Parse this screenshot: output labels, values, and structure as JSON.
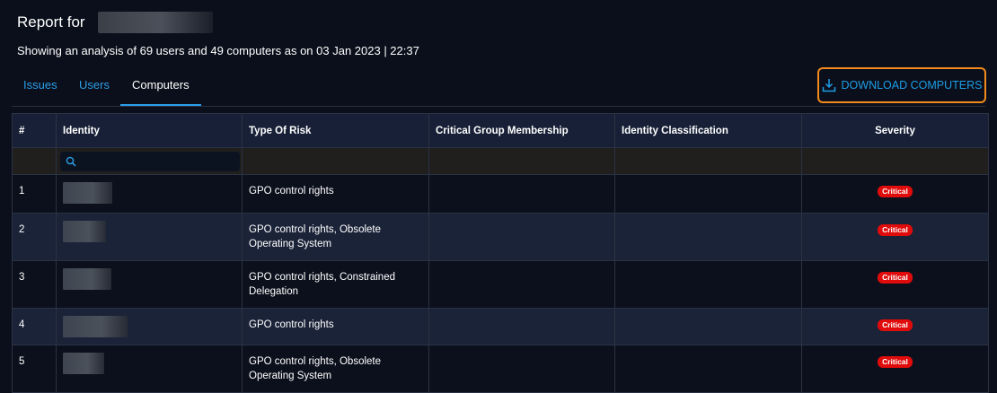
{
  "header": {
    "title": "Report for",
    "subtitle": "Showing an analysis of 69 users and 49 computers as on 03 Jan 2023 | 22:37"
  },
  "tabs": [
    {
      "label": "Issues",
      "active": false
    },
    {
      "label": "Users",
      "active": false
    },
    {
      "label": "Computers",
      "active": true
    }
  ],
  "download_button": {
    "label": "DOWNLOAD COMPUTERS",
    "icon": "download-icon"
  },
  "table": {
    "columns": [
      "#",
      "Identity",
      "Type Of Risk",
      "Critical Group Membership",
      "Identity Classification",
      "Severity"
    ],
    "search_icon": "search-icon",
    "rows": [
      {
        "num": "1",
        "risk": "GPO control rights",
        "group": "",
        "classification": "",
        "severity": "Critical"
      },
      {
        "num": "2",
        "risk": "GPO control rights,  Obsolete Operating System",
        "group": "",
        "classification": "",
        "severity": "Critical"
      },
      {
        "num": "3",
        "risk": "GPO control rights,  Constrained Delegation",
        "group": "",
        "classification": "",
        "severity": "Critical"
      },
      {
        "num": "4",
        "risk": "GPO control rights",
        "group": "",
        "classification": "",
        "severity": "Critical"
      },
      {
        "num": "5",
        "risk": "GPO control rights,  Obsolete Operating System",
        "group": "",
        "classification": "",
        "severity": "Critical"
      }
    ]
  },
  "colors": {
    "background": "#0b0f1b",
    "accent": "#2c9ee8",
    "button_border": "#f28a1b",
    "critical": "#e00b0b"
  }
}
